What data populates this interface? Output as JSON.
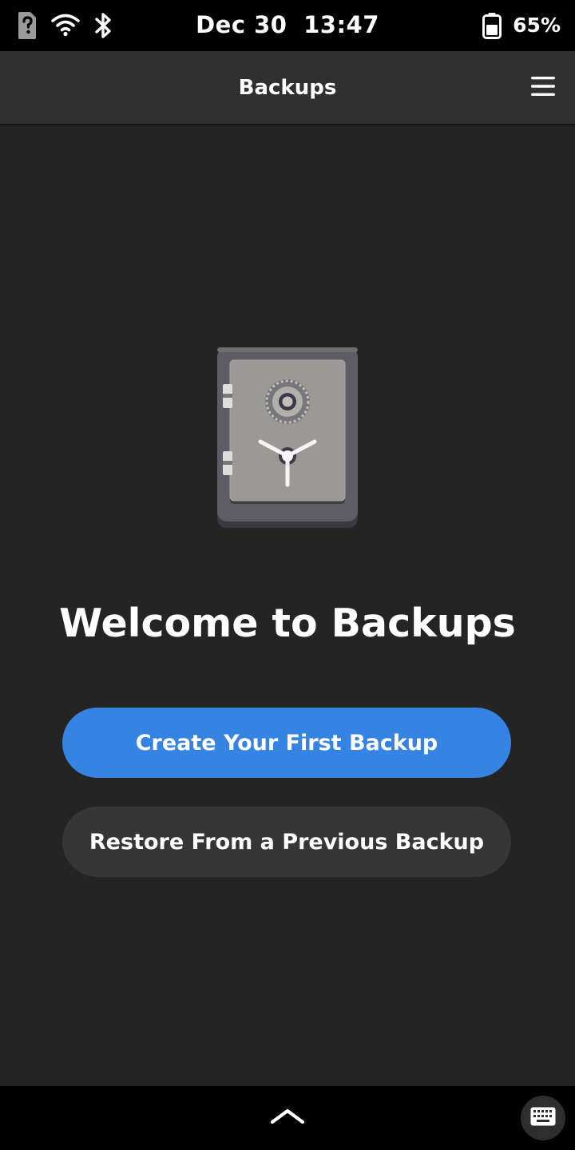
{
  "status_bar": {
    "date": "Dec 30",
    "time": "13:47",
    "battery_percent": "65%",
    "icons": [
      "sim-unknown-icon",
      "wifi-icon",
      "bluetooth-icon",
      "battery-icon"
    ]
  },
  "header": {
    "title": "Backups",
    "menu_icon": "hamburger-menu-icon"
  },
  "main": {
    "illustration": "safe-icon",
    "welcome_text": "Welcome to Backups",
    "primary_button": "Create Your First Backup",
    "secondary_button": "Restore From a Previous Backup"
  },
  "nav_bar": {
    "up_icon": "chevron-up-icon",
    "keyboard_icon": "keyboard-icon"
  },
  "colors": {
    "accent": "#3584e4",
    "background": "#242424",
    "header": "#303030",
    "secondary_button": "#363636"
  }
}
